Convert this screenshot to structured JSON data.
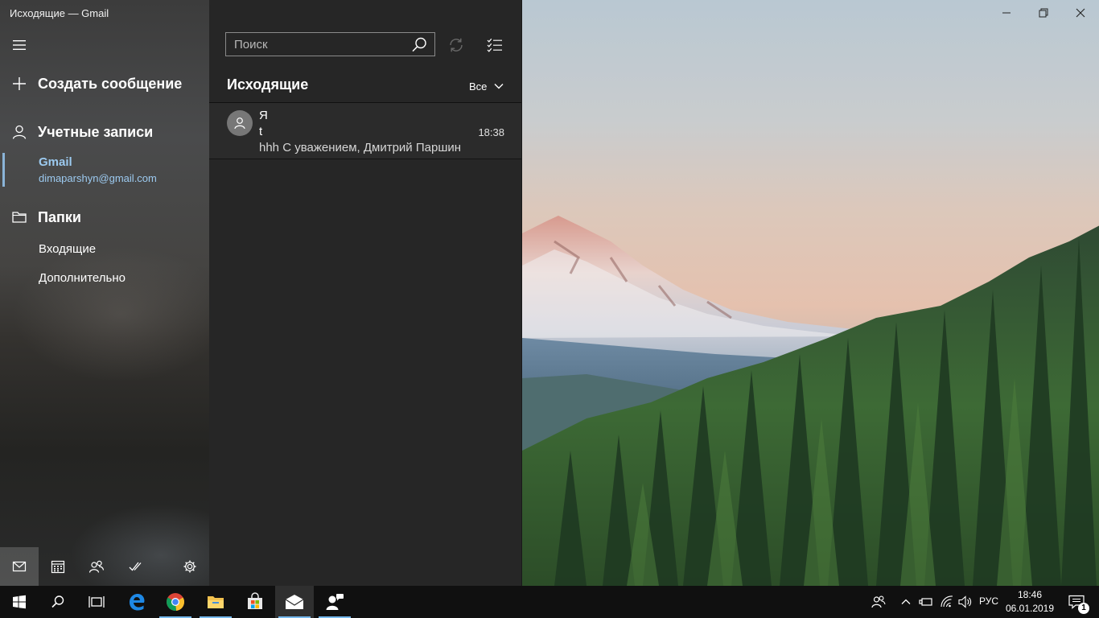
{
  "window": {
    "title": "Исходящие — Gmail"
  },
  "nav": {
    "compose_label": "Создать сообщение",
    "accounts_label": "Учетные записи",
    "account": {
      "name": "Gmail",
      "email": "dimaparshyn@gmail.com"
    },
    "folders_label": "Папки",
    "folders": [
      {
        "label": "Входящие"
      },
      {
        "label": "Дополнительно"
      }
    ],
    "bottom_icons": [
      "mail-icon",
      "calendar-icon",
      "people-icon",
      "todo-icon",
      "settings-icon"
    ]
  },
  "list": {
    "search": {
      "placeholder": "Поиск"
    },
    "folder_title": "Исходящие",
    "filter_label": "Все",
    "messages": [
      {
        "sender": "Я",
        "subject": "t",
        "preview": "hhh С уважением, Дмитрий Паршин",
        "time": "18:38"
      }
    ]
  },
  "taskbar": {
    "apps": [
      "start-icon",
      "search-icon",
      "task-view-icon",
      "edge-icon",
      "chrome-icon",
      "file-explorer-icon",
      "store-icon",
      "mail-app-icon",
      "people-app-icon"
    ],
    "language": "РУС",
    "time": "18:46",
    "date": "06.01.2019",
    "notification_count": "1"
  },
  "colors": {
    "accent": "#76b9ed",
    "account_highlight": "#9ccaf0",
    "list_bg": "#262626",
    "taskbar_bg": "#101010"
  }
}
